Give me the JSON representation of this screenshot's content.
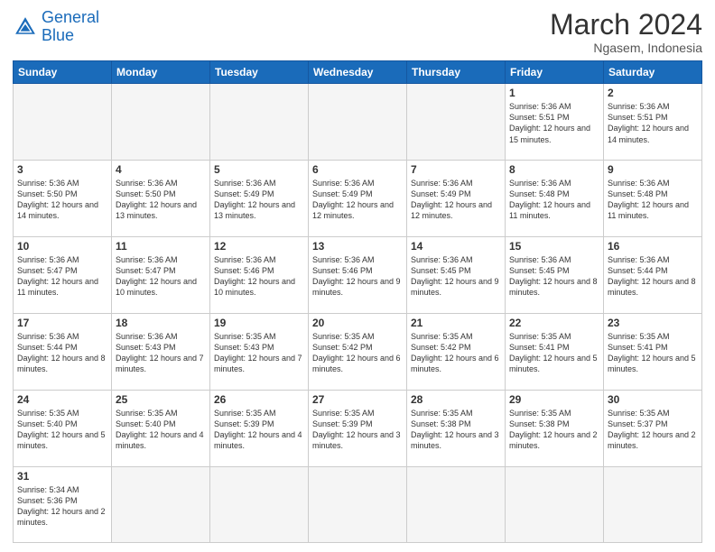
{
  "header": {
    "logo_general": "General",
    "logo_blue": "Blue",
    "title": "March 2024",
    "subtitle": "Ngasem, Indonesia"
  },
  "days_of_week": [
    "Sunday",
    "Monday",
    "Tuesday",
    "Wednesday",
    "Thursday",
    "Friday",
    "Saturday"
  ],
  "weeks": [
    [
      {
        "day": "",
        "info": ""
      },
      {
        "day": "",
        "info": ""
      },
      {
        "day": "",
        "info": ""
      },
      {
        "day": "",
        "info": ""
      },
      {
        "day": "",
        "info": ""
      },
      {
        "day": "1",
        "info": "Sunrise: 5:36 AM\nSunset: 5:51 PM\nDaylight: 12 hours\nand 15 minutes."
      },
      {
        "day": "2",
        "info": "Sunrise: 5:36 AM\nSunset: 5:51 PM\nDaylight: 12 hours\nand 14 minutes."
      }
    ],
    [
      {
        "day": "3",
        "info": "Sunrise: 5:36 AM\nSunset: 5:50 PM\nDaylight: 12 hours\nand 14 minutes."
      },
      {
        "day": "4",
        "info": "Sunrise: 5:36 AM\nSunset: 5:50 PM\nDaylight: 12 hours\nand 13 minutes."
      },
      {
        "day": "5",
        "info": "Sunrise: 5:36 AM\nSunset: 5:49 PM\nDaylight: 12 hours\nand 13 minutes."
      },
      {
        "day": "6",
        "info": "Sunrise: 5:36 AM\nSunset: 5:49 PM\nDaylight: 12 hours\nand 12 minutes."
      },
      {
        "day": "7",
        "info": "Sunrise: 5:36 AM\nSunset: 5:49 PM\nDaylight: 12 hours\nand 12 minutes."
      },
      {
        "day": "8",
        "info": "Sunrise: 5:36 AM\nSunset: 5:48 PM\nDaylight: 12 hours\nand 11 minutes."
      },
      {
        "day": "9",
        "info": "Sunrise: 5:36 AM\nSunset: 5:48 PM\nDaylight: 12 hours\nand 11 minutes."
      }
    ],
    [
      {
        "day": "10",
        "info": "Sunrise: 5:36 AM\nSunset: 5:47 PM\nDaylight: 12 hours\nand 11 minutes."
      },
      {
        "day": "11",
        "info": "Sunrise: 5:36 AM\nSunset: 5:47 PM\nDaylight: 12 hours\nand 10 minutes."
      },
      {
        "day": "12",
        "info": "Sunrise: 5:36 AM\nSunset: 5:46 PM\nDaylight: 12 hours\nand 10 minutes."
      },
      {
        "day": "13",
        "info": "Sunrise: 5:36 AM\nSunset: 5:46 PM\nDaylight: 12 hours\nand 9 minutes."
      },
      {
        "day": "14",
        "info": "Sunrise: 5:36 AM\nSunset: 5:45 PM\nDaylight: 12 hours\nand 9 minutes."
      },
      {
        "day": "15",
        "info": "Sunrise: 5:36 AM\nSunset: 5:45 PM\nDaylight: 12 hours\nand 8 minutes."
      },
      {
        "day": "16",
        "info": "Sunrise: 5:36 AM\nSunset: 5:44 PM\nDaylight: 12 hours\nand 8 minutes."
      }
    ],
    [
      {
        "day": "17",
        "info": "Sunrise: 5:36 AM\nSunset: 5:44 PM\nDaylight: 12 hours\nand 8 minutes."
      },
      {
        "day": "18",
        "info": "Sunrise: 5:36 AM\nSunset: 5:43 PM\nDaylight: 12 hours\nand 7 minutes."
      },
      {
        "day": "19",
        "info": "Sunrise: 5:35 AM\nSunset: 5:43 PM\nDaylight: 12 hours\nand 7 minutes."
      },
      {
        "day": "20",
        "info": "Sunrise: 5:35 AM\nSunset: 5:42 PM\nDaylight: 12 hours\nand 6 minutes."
      },
      {
        "day": "21",
        "info": "Sunrise: 5:35 AM\nSunset: 5:42 PM\nDaylight: 12 hours\nand 6 minutes."
      },
      {
        "day": "22",
        "info": "Sunrise: 5:35 AM\nSunset: 5:41 PM\nDaylight: 12 hours\nand 5 minutes."
      },
      {
        "day": "23",
        "info": "Sunrise: 5:35 AM\nSunset: 5:41 PM\nDaylight: 12 hours\nand 5 minutes."
      }
    ],
    [
      {
        "day": "24",
        "info": "Sunrise: 5:35 AM\nSunset: 5:40 PM\nDaylight: 12 hours\nand 5 minutes."
      },
      {
        "day": "25",
        "info": "Sunrise: 5:35 AM\nSunset: 5:40 PM\nDaylight: 12 hours\nand 4 minutes."
      },
      {
        "day": "26",
        "info": "Sunrise: 5:35 AM\nSunset: 5:39 PM\nDaylight: 12 hours\nand 4 minutes."
      },
      {
        "day": "27",
        "info": "Sunrise: 5:35 AM\nSunset: 5:39 PM\nDaylight: 12 hours\nand 3 minutes."
      },
      {
        "day": "28",
        "info": "Sunrise: 5:35 AM\nSunset: 5:38 PM\nDaylight: 12 hours\nand 3 minutes."
      },
      {
        "day": "29",
        "info": "Sunrise: 5:35 AM\nSunset: 5:38 PM\nDaylight: 12 hours\nand 2 minutes."
      },
      {
        "day": "30",
        "info": "Sunrise: 5:35 AM\nSunset: 5:37 PM\nDaylight: 12 hours\nand 2 minutes."
      }
    ],
    [
      {
        "day": "31",
        "info": "Sunrise: 5:34 AM\nSunset: 5:36 PM\nDaylight: 12 hours\nand 2 minutes."
      },
      {
        "day": "",
        "info": ""
      },
      {
        "day": "",
        "info": ""
      },
      {
        "day": "",
        "info": ""
      },
      {
        "day": "",
        "info": ""
      },
      {
        "day": "",
        "info": ""
      },
      {
        "day": "",
        "info": ""
      }
    ]
  ]
}
